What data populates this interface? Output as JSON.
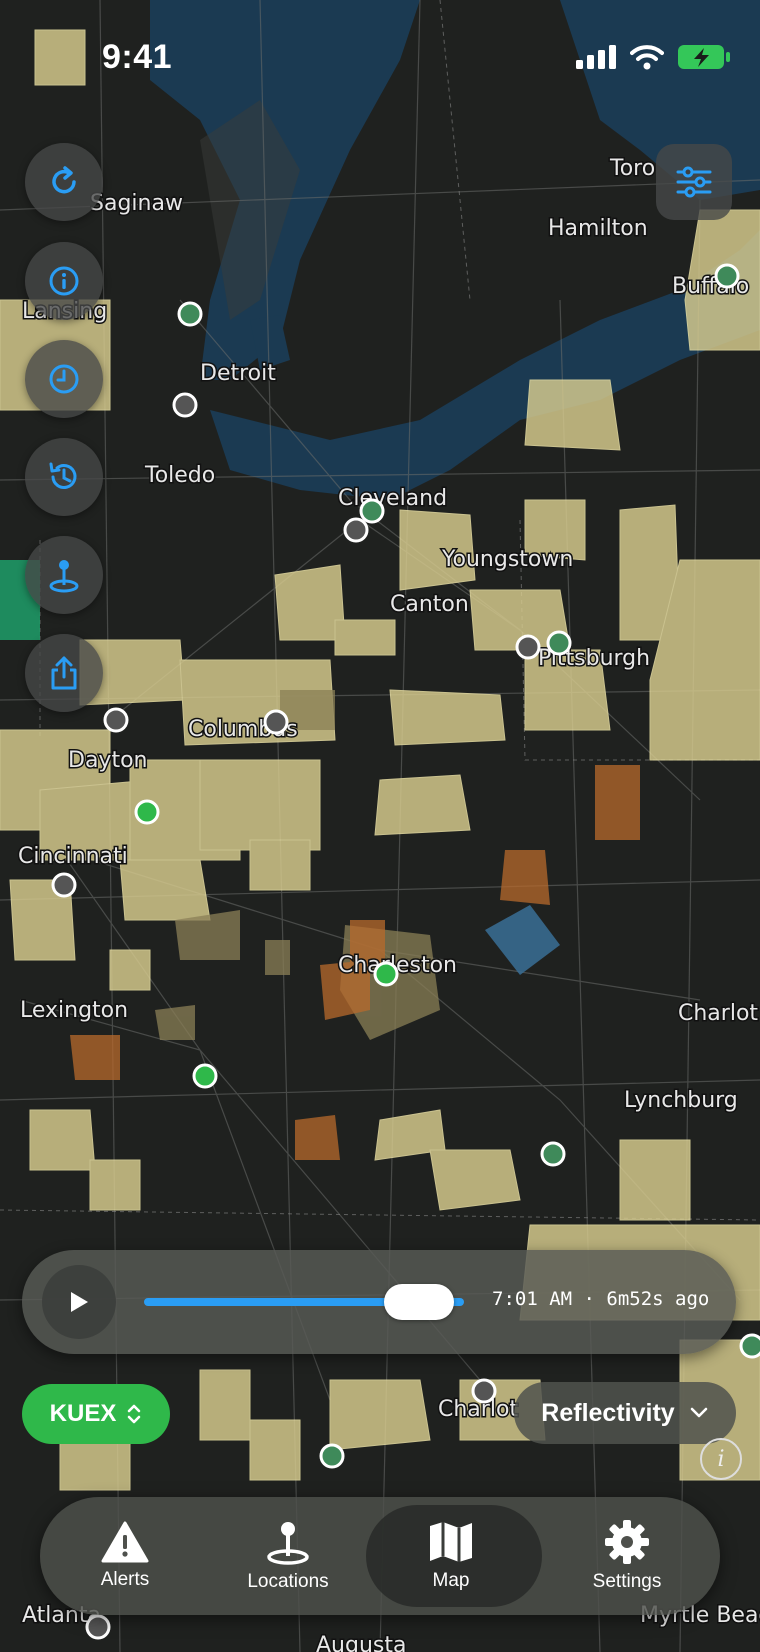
{
  "status_bar": {
    "time": "9:41"
  },
  "map": {
    "cities": [
      "Saginaw",
      "Toro",
      "Hamilton",
      "Buffalo",
      "Lansing",
      "Detroit",
      "Toledo",
      "Cleveland",
      "Youngstown",
      "Canton",
      "Pittsburgh",
      "Columbus",
      "Dayton",
      "Cincinnati",
      "Charleston",
      "Lexington",
      "Charlot",
      "Lynchburg",
      "Charlot",
      "Atlanta",
      "Augusta",
      "Myrtle Beach"
    ]
  },
  "timeline": {
    "time_label": "7:01 AM · 6m52s ago",
    "progress": 0.86
  },
  "station": {
    "code": "KUEX"
  },
  "product": {
    "name": "Reflectivity"
  },
  "tabs": [
    {
      "label": "Alerts",
      "icon": "warning-icon"
    },
    {
      "label": "Locations",
      "icon": "location-pin-icon"
    },
    {
      "label": "Map",
      "icon": "map-icon",
      "active": true
    },
    {
      "label": "Settings",
      "icon": "gear-icon"
    }
  ],
  "colors": {
    "accent": "#2a9df4",
    "station_green": "#2fb84a",
    "warning_zone": "#d9cd8f"
  }
}
